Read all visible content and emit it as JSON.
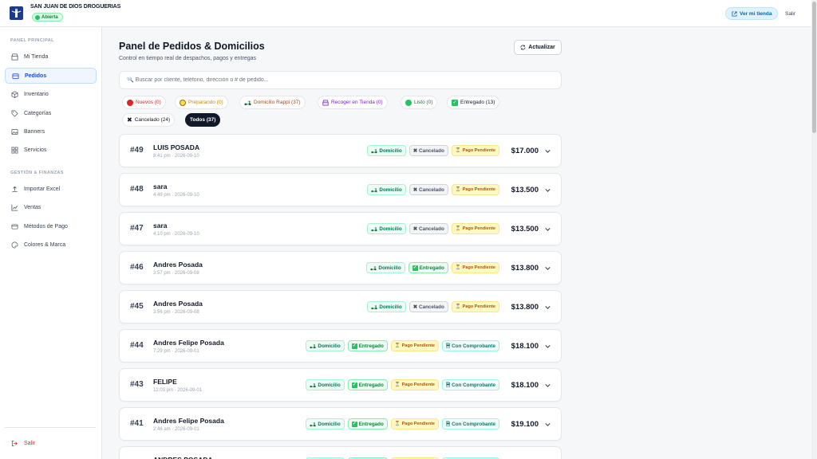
{
  "header": {
    "store_name": "SAN JUAN DE DIOS DROGUERIAS",
    "status": "Abierta",
    "view_store": "Ver mi tienda",
    "logout": "Salir"
  },
  "sidebar": {
    "section_main": "PANEL PRINCIPAL",
    "items_main": [
      {
        "label": "Mi Tienda",
        "icon": "store-icon"
      },
      {
        "label": "Pedidos",
        "icon": "orders-icon",
        "active": true
      },
      {
        "label": "Inventario",
        "icon": "box-icon"
      },
      {
        "label": "Categorías",
        "icon": "tag-icon"
      },
      {
        "label": "Banners",
        "icon": "image-icon"
      },
      {
        "label": "Servicios",
        "icon": "grid-icon"
      }
    ],
    "section_mgmt": "GESTIÓN & FINANZAS",
    "items_mgmt": [
      {
        "label": "Importar Excel",
        "icon": "upload-icon"
      },
      {
        "label": "Ventas",
        "icon": "chart-icon"
      },
      {
        "label": "Métodos de Pago",
        "icon": "card-icon"
      },
      {
        "label": "Colores & Marca",
        "icon": "palette-icon"
      }
    ],
    "logout": "Salir"
  },
  "main": {
    "title": "Panel de Pedidos & Domicilios",
    "subtitle": "Control en tiempo real de despachos, pagos y entregas",
    "refresh": "Actualizar",
    "search_placeholder": "🔍 Buscar por cliente, teléfono, dirección o # de pedido..."
  },
  "filters": [
    {
      "label": "Nuevos (0)",
      "color": "#dc2626",
      "icon": "red-circle"
    },
    {
      "label": "Preparando (0)",
      "color": "#ca8a04",
      "icon": "yellow-circle"
    },
    {
      "label": "Domicilio Rappi (37)",
      "color": "#c2410c",
      "icon": "scooter-icon"
    },
    {
      "label": "Recoger en Tienda (0)",
      "color": "#7e22ce",
      "icon": "store-icon"
    },
    {
      "label": "Listo (0)",
      "color": "#15803d",
      "icon": "green-circle"
    },
    {
      "label": "Entregado (13)",
      "color": "#111827",
      "icon": "check-box"
    },
    {
      "label": "Cancelado (24)",
      "color": "#111827",
      "icon": "x-icon"
    },
    {
      "label": "Todos (37)",
      "color": "#ffffff",
      "icon": "none",
      "active": true
    }
  ],
  "labels": {
    "domicilio": "Domicilio",
    "cancelado": "Cancelado",
    "entregado": "Entregado",
    "pago_pendiente": "Pago Pendiente",
    "con_comprobante": "Con Comprobante"
  },
  "orders": [
    {
      "num": "#49",
      "customer": "LUIS POSADA",
      "time": "8:41 pm · 2026-09-10",
      "status": "cancelado",
      "comprobante": false,
      "total": "$17.000"
    },
    {
      "num": "#48",
      "customer": "sara",
      "time": "4:49 pm · 2026-09-10",
      "status": "cancelado",
      "comprobante": false,
      "total": "$13.500"
    },
    {
      "num": "#47",
      "customer": "sara",
      "time": "4:10 pm · 2026-09-10",
      "status": "cancelado",
      "comprobante": false,
      "total": "$13.500"
    },
    {
      "num": "#46",
      "customer": "Andres Posada",
      "time": "3:57 pm · 2026-09-08",
      "status": "entregado",
      "comprobante": false,
      "total": "$13.800"
    },
    {
      "num": "#45",
      "customer": "Andres Posada",
      "time": "3:56 pm · 2026-09-08",
      "status": "cancelado",
      "comprobante": false,
      "total": "$13.800"
    },
    {
      "num": "#44",
      "customer": "Andres Felipe Posada",
      "time": "7:29 pm · 2026-09-01",
      "status": "entregado",
      "comprobante": true,
      "total": "$18.100"
    },
    {
      "num": "#43",
      "customer": "FELIPE",
      "time": "12:03 pm · 2026-09-01",
      "status": "entregado",
      "comprobante": true,
      "total": "$18.100"
    },
    {
      "num": "#41",
      "customer": "Andres Felipe Posada",
      "time": "2:46 am · 2026-09-01",
      "status": "entregado",
      "comprobante": true,
      "total": "$19.100"
    },
    {
      "num": "",
      "customer": "ANDRES POSADA",
      "time": "",
      "status": "entregado",
      "comprobante": true,
      "total": ""
    }
  ],
  "colors": {
    "accent": "#1d4ed8",
    "sidebar_active_bg": "#eff6ff",
    "logout": "#dc2626",
    "dark_chip": "#111827"
  }
}
